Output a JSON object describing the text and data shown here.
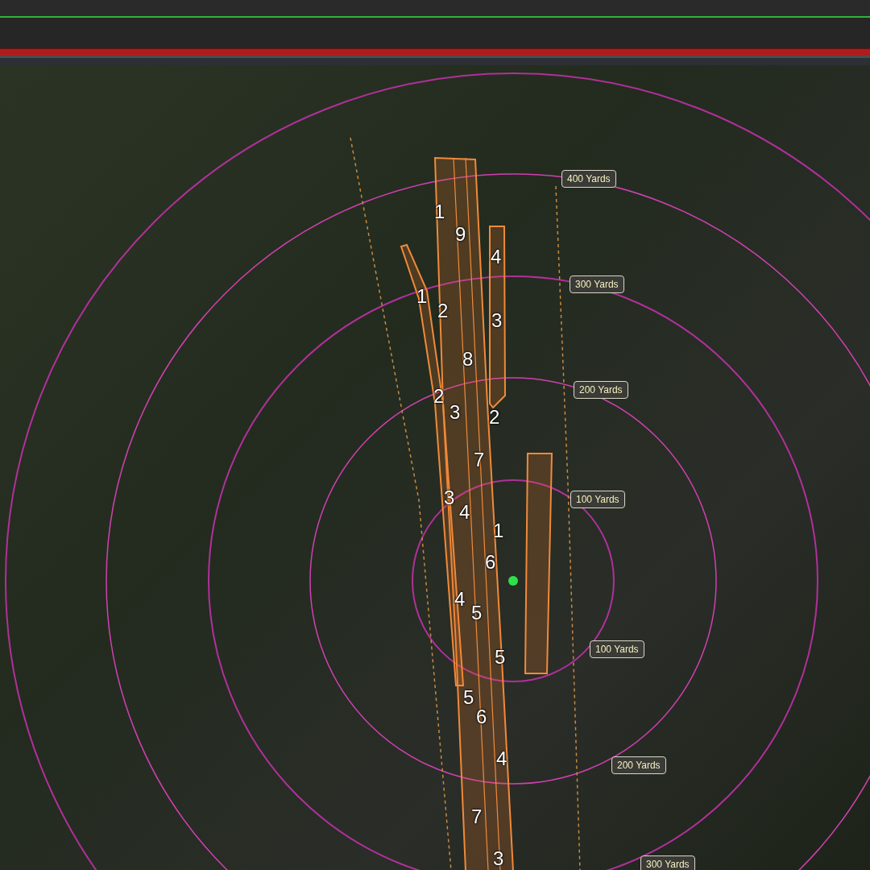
{
  "map": {
    "range_labels": [
      {
        "text": "400 Yards"
      },
      {
        "text": "300 Yards"
      },
      {
        "text": "200 Yards"
      },
      {
        "text": "100 Yards"
      },
      {
        "text": "100 Yards"
      },
      {
        "text": "200 Yards"
      },
      {
        "text": "300 Yards"
      }
    ],
    "lane_numbers": [
      "1",
      "9",
      "4",
      "1",
      "2",
      "3",
      "8",
      "2",
      "3",
      "2",
      "7",
      "3",
      "4",
      "1",
      "6",
      "4",
      "5",
      "5",
      "5",
      "6",
      "4",
      "7",
      "3"
    ]
  }
}
